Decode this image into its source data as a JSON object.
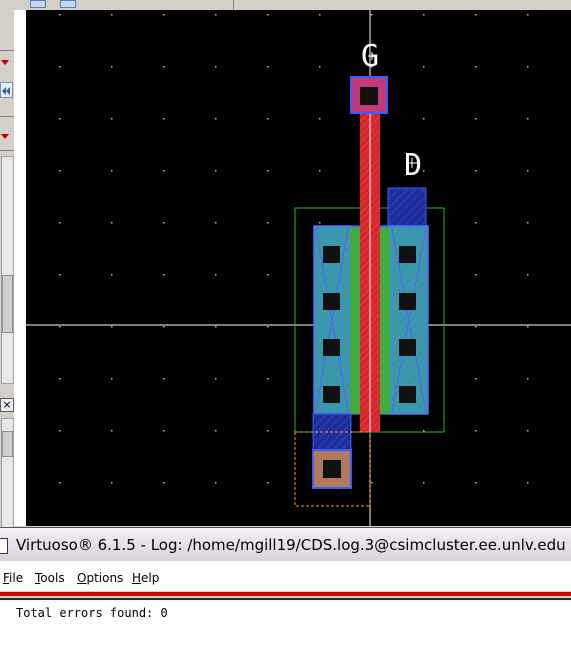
{
  "window": {
    "title": "Virtuoso® 6.1.5 - Log: /home/mgill19/CDS.log.3@csimcluster.ee.unlv.edu"
  },
  "menu": {
    "file": {
      "mnemonic": "F",
      "rest": "ile"
    },
    "tools": {
      "mnemonic": "T",
      "rest": "ools"
    },
    "options": {
      "mnemonic": "O",
      "rest": "ptions"
    },
    "help": {
      "mnemonic": "H",
      "rest": "elp"
    }
  },
  "log": {
    "text": "Total errors found: 0"
  },
  "layout": {
    "pin_gate": "G",
    "pin_drain": "D"
  },
  "icons": {
    "close": "close-icon",
    "chevron": "chevron-down-icon",
    "rewind": "rewind-icon",
    "pin_marker": "pin-cross-icon"
  },
  "colors": {
    "canvas": "#000000",
    "poly": "#e03030",
    "metal1": "#2a3fe0",
    "metal1_outline": "#3a5bff",
    "active": "#3fae3f",
    "diffusion_fill": "#3a9aa8",
    "contact": "#111111",
    "nimplant_outline": "#22bb22",
    "gate_pad": "#c03a78",
    "sub_contact_fill": "#b07a5a",
    "highlight_dash": "#ff9b2a",
    "crosshair": "#ffffff",
    "log_separator": "#cc0000"
  }
}
